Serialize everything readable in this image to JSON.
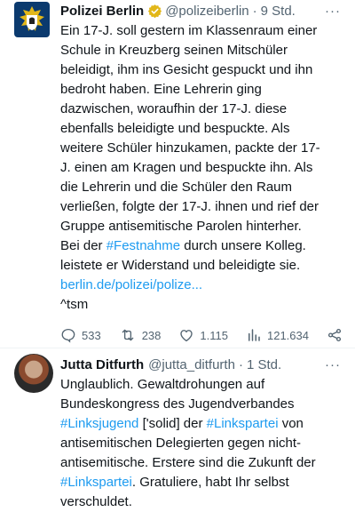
{
  "tweet1": {
    "display_name": "Polizei Berlin",
    "handle": "@polizeiberlin",
    "separator": "·",
    "time": "9 Std.",
    "more": "···",
    "lines": [
      "Ein 17-J. soll gestern im Klassenraum einer",
      "Schule in Kreuzberg seinen Mitschüler",
      "beleidigt, ihm ins Gesicht gespuckt und ihn",
      "bedroht haben. Eine Lehrerin ging",
      "dazwischen, woraufhin der 17-J. diese",
      "ebenfalls beleidigte und bespuckte. Als",
      "weitere Schüler hinzukamen, packte der 17-",
      "J. einen am Kragen und bespuckte ihn. Als",
      "die Lehrerin und die Schüler den Raum",
      "verließen, folgte der 17-J. ihnen und rief der",
      "Gruppe antisemitische Parolen hinterher."
    ],
    "line12_pre": "Bei der ",
    "hashtag_festnahme": "#Festnahme",
    "line12_post": " durch unsere Kolleg.",
    "line13": "leistete er Widerstand und beleidigte sie.",
    "link": "berlin.de/polizei/polize...",
    "signature": "^tsm",
    "replies": "533",
    "reposts": "238",
    "likes": "1.115",
    "views": "121.634"
  },
  "tweet2": {
    "display_name": "Jutta Ditfurth",
    "handle": "@jutta_ditfurth",
    "separator": "·",
    "time": "1 Std.",
    "more": "···",
    "line1": "Unglaublich. Gewaltdrohungen auf",
    "line2": "Bundeskongress des Jugendverbandes",
    "hashtag_linksjugend": "#Linksjugend",
    "line3_mid": " ['solid] der ",
    "hashtag_linkspartei": "#Linkspartei",
    "line3_post": " von",
    "line4": "antisemitischen Delegierten gegen nicht-",
    "line5": "antisemitische. Erstere sind die Zukunft der",
    "hashtag_linkspartei2": "#Linkspartei",
    "line6_post": ". Gratuliere, habt Ihr selbst",
    "line7": "verschuldet."
  },
  "colors": {
    "link": "#1d9bf0",
    "secondary_text": "#536471",
    "verified_gold": "#e2b719",
    "police_blue": "#0b3a6e"
  },
  "icons": [
    "police-crest-icon",
    "verified-badge-icon",
    "reply-icon",
    "repost-icon",
    "like-icon",
    "views-icon",
    "share-icon"
  ]
}
